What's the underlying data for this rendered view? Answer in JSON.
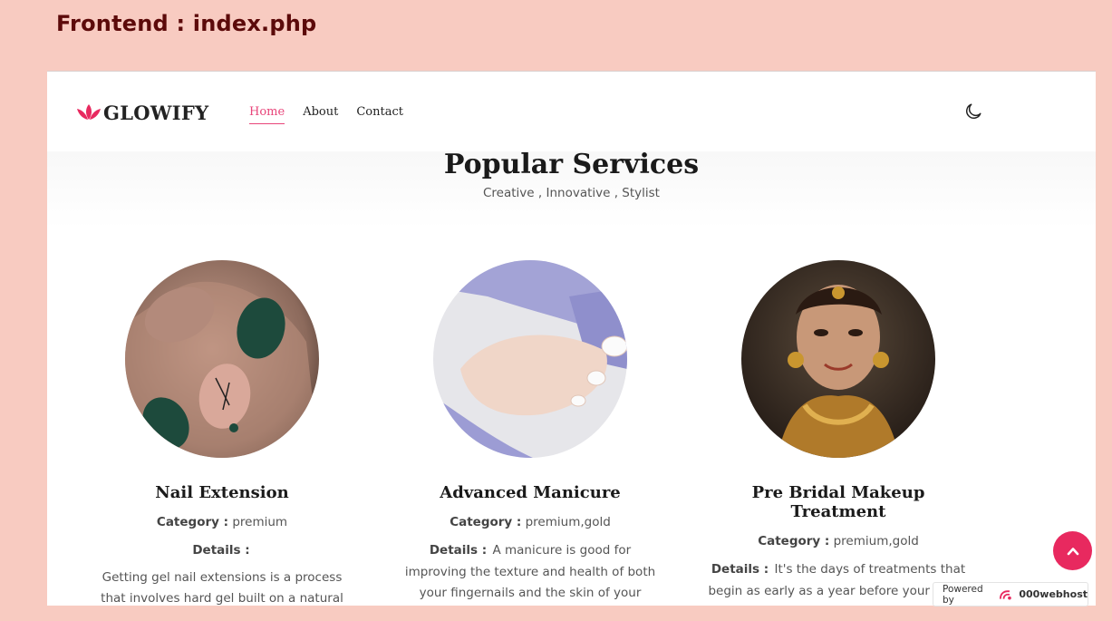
{
  "slide_title": "Frontend : index.php",
  "brand": {
    "name": "GLOWIFY"
  },
  "nav": [
    {
      "label": "Home",
      "active": true
    },
    {
      "label": "About",
      "active": false
    },
    {
      "label": "Contact",
      "active": false
    }
  ],
  "section": {
    "title": "Popular Services",
    "subtitle": "Creative , Innovative , Stylist"
  },
  "labels": {
    "category": "Category :",
    "details": "Details :"
  },
  "cards": [
    {
      "title": "Nail Extension",
      "category": "premium",
      "details_inline": "",
      "details_para": "Getting gel nail extensions is a process that involves hard gel built on a natural nail and"
    },
    {
      "title": "Advanced Manicure",
      "category": "premium,gold",
      "details_inline": "A manicure is good for improving the texture and health of both your fingernails and the skin of your hands, as well as leaving them",
      "details_para": ""
    },
    {
      "title": "Pre Bridal Makeup Treatment",
      "category": "premium,gold",
      "details_inline": "It's the days of treatments that begin as early as a year before your d-day for that perfect glow on the wedding day. And who",
      "details_para": ""
    }
  ],
  "powered": {
    "prefix": "Powered by",
    "name": "000webhost"
  },
  "colors": {
    "accent": "#e8457a",
    "page_bg": "#f8cbc1",
    "slide_title": "#5c0a0a",
    "scroll_button": "#e8295f"
  },
  "icons": {
    "theme_toggle": "moon-icon",
    "scroll_top": "chevron-up-icon",
    "brand_logo": "lotus-icon"
  }
}
